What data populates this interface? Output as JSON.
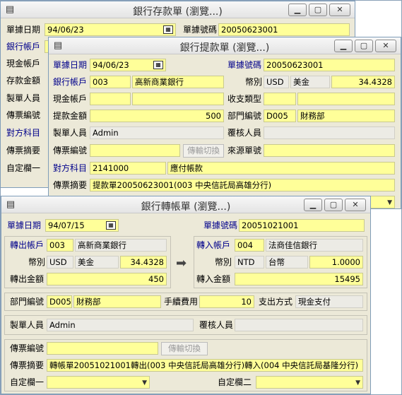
{
  "win1": {
    "title": "銀行存款單 (瀏覽...)",
    "date_label": "單據日期",
    "date": "94/06/23",
    "no_label": "單據號碼",
    "no": "20050623001",
    "labels": [
      "銀行帳戶",
      "現金帳戶",
      "存款金額",
      "製單人員",
      "傳票編號",
      "對方科目",
      "傳票摘要",
      "自定欄一"
    ]
  },
  "win2": {
    "title": "銀行提款單 (瀏覽...)",
    "date_label": "單據日期",
    "date": "94/06/23",
    "no_label": "單據號碼",
    "no": "20050623001",
    "bank_label": "銀行帳戶",
    "bank_code": "003",
    "bank_name": "高新商業銀行",
    "currency_label": "幣別",
    "currency_code": "USD",
    "currency_name": "美金",
    "rate": "34.4328",
    "cash_label": "現金帳戶",
    "type_label": "收支類型",
    "amount_label": "提款金額",
    "amount": "500",
    "dept_label": "部門編號",
    "dept_code": "D005",
    "dept_name": "財務部",
    "maker_label": "製單人員",
    "maker": "Admin",
    "reviewer_label": "覆核人員",
    "voucher_label": "傳票編號",
    "transfer_btn": "傳輸切換",
    "source_label": "來源單號",
    "account_label": "對方科目",
    "account_code": "2141000",
    "account_name": "應付帳款",
    "summary_label": "傳票摘要",
    "summary": "提款單20050623001(003 中央信託局高雄分行)"
  },
  "win3": {
    "title": "銀行轉帳單 (瀏覽...)",
    "date_label": "單據日期",
    "date": "94/07/15",
    "no_label": "單據號碼",
    "no": "20051021001",
    "out_label": "轉出帳戶",
    "out_code": "003",
    "out_name": "高新商業銀行",
    "out_currency_label": "幣別",
    "out_currency_code": "USD",
    "out_currency_name": "美金",
    "out_rate": "34.4328",
    "out_amount_label": "轉出金額",
    "out_amount": "450",
    "in_label": "轉入帳戶",
    "in_code": "004",
    "in_name": "法商佳信銀行",
    "in_currency_label": "幣別",
    "in_currency_code": "NTD",
    "in_currency_name": "台幣",
    "in_rate": "1.0000",
    "in_amount_label": "轉入金額",
    "in_amount": "15495",
    "dept_label": "部門編號",
    "dept_code": "D005",
    "dept_name": "財務部",
    "fee_label": "手續費用",
    "fee": "10",
    "pay_label": "支出方式",
    "pay": "現金支付",
    "maker_label": "製單人員",
    "maker": "Admin",
    "reviewer_label": "覆核人員",
    "voucher_label": "傳票編號",
    "transfer_btn": "傳輸切換",
    "summary_label": "傳票摘要",
    "summary": "轉帳單20051021001轉出(003 中央信託局高雄分行)轉入(004 中央信託局基隆分行)",
    "custom1_label": "自定欄一",
    "custom2_label": "自定欄二"
  },
  "icons": {
    "app": "document-edit-icon",
    "minimize": "minimize-icon",
    "maximize": "maximize-icon",
    "close": "close-icon",
    "calendar": "calendar-icon",
    "arrow": "right-arrow-icon",
    "dropdown": "chevron-down-icon"
  },
  "colors": {
    "field": "#ffff99",
    "window": "#ece9d8",
    "label_accent": "#00008b"
  }
}
